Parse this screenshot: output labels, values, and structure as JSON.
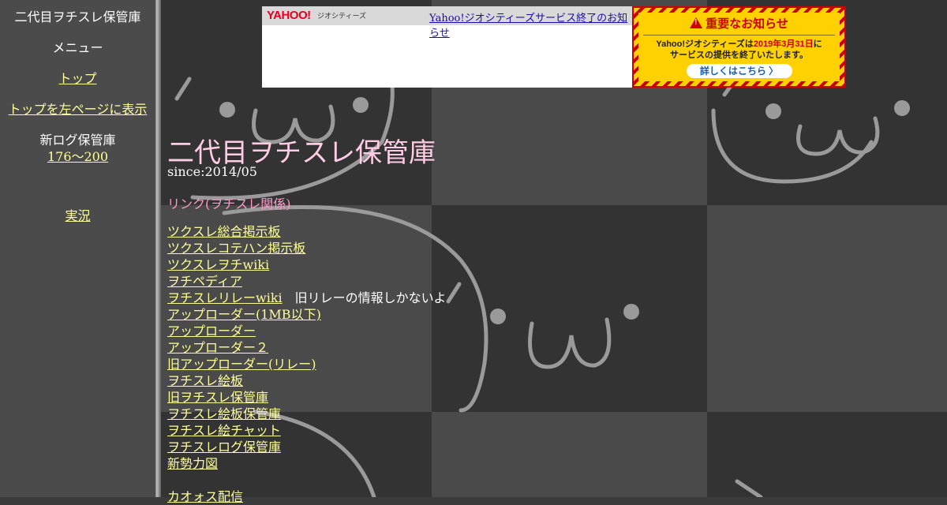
{
  "sidebar": {
    "site_title": "二代目ヲチスレ保管庫",
    "menu_label": "メニュー",
    "top_link": "トップ",
    "top_left_link": "トップを左ページに表示",
    "newlog_label": "新ログ保管庫",
    "newlog_range": "176～200",
    "live_link": "実況"
  },
  "ad": {
    "logo": "YAHOO!",
    "logo_sub": "ジオシティーズ",
    "link": "Yahoo!ジオシティーズサービス終了のお知らせ",
    "notice_title": "重要なお知らせ",
    "notice_line1_a": "Yahoo!ジオシティーズは",
    "notice_line1_date": "2019年3月31日",
    "notice_line1_b": "に",
    "notice_line2": "サービスの提供を終了いたします。",
    "notice_button": "詳しくはこちら 〉",
    "colors": {
      "stripe_red": "#cc0000",
      "stripe_yellow": "#ffd100"
    }
  },
  "main": {
    "title": "二代目ヲチスレ保管庫",
    "since": "since:2014/05",
    "section": "リンク(ヲチスレ関係)",
    "links": [
      {
        "label": "ツクスレ総合掲示板",
        "note": ""
      },
      {
        "label": "ツクスレコテハン掲示板",
        "note": ""
      },
      {
        "label": "ツクスレヲチwiki",
        "note": ""
      },
      {
        "label": "ヲチペディア",
        "note": ""
      },
      {
        "label": "ヲチスレリレーwiki",
        "note": "旧リレーの情報しかないよ"
      },
      {
        "label": "アップローダー(1MB以下)",
        "note": ""
      },
      {
        "label": "アップローダー",
        "note": ""
      },
      {
        "label": "アップローダー２",
        "note": ""
      },
      {
        "label": "旧アップローダー(リレー)",
        "note": ""
      },
      {
        "label": "ヲチスレ絵板",
        "note": ""
      },
      {
        "label": "旧ヲチスレ保管庫",
        "note": ""
      },
      {
        "label": "ヲチスレ絵板保管庫",
        "note": ""
      },
      {
        "label": "ヲチスレ絵チャット",
        "note": ""
      },
      {
        "label": "ヲチスレログ保管庫",
        "note": ""
      },
      {
        "label": "新勢力図",
        "note": ""
      }
    ],
    "bottom_link": "カオォス配信"
  },
  "colors": {
    "sidebar_bg": "#4b4b4b",
    "link": "#ffff99",
    "title": "#ffcce6",
    "section": "#ff99cc",
    "tile_dark": "#333333",
    "tile_light": "#4a4a4a"
  }
}
